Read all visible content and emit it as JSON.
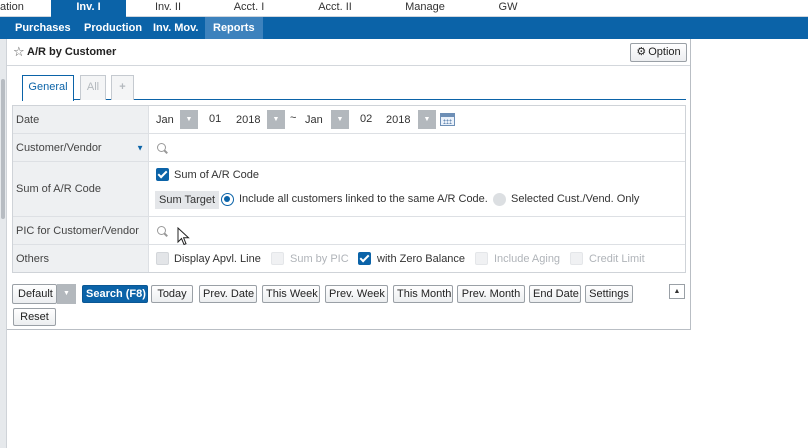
{
  "top_menu": {
    "items": [
      {
        "label": "ation"
      },
      {
        "label": "Inv. I",
        "active": true
      },
      {
        "label": "Inv. II"
      },
      {
        "label": "Acct. I"
      },
      {
        "label": "Acct. II"
      },
      {
        "label": "Manage"
      },
      {
        "label": "GW"
      }
    ]
  },
  "sub_menu": {
    "items": [
      {
        "label": "Purchases"
      },
      {
        "label": "Production"
      },
      {
        "label": "Inv. Mov."
      },
      {
        "label": "Reports",
        "active": true
      }
    ]
  },
  "panel": {
    "title": "A/R by Customer",
    "option_label": "Option",
    "star_icon": "star-outline-icon",
    "gear_icon": "gear-icon"
  },
  "tabs": [
    {
      "label": "General",
      "active": true
    },
    {
      "label": "All"
    },
    {
      "label": "+"
    }
  ],
  "form": {
    "date": {
      "label": "Date",
      "from_month": "Jan",
      "from_day": "01",
      "from_year": "2018",
      "separator": "~",
      "to_month": "Jan",
      "to_day": "02",
      "to_year": "2018"
    },
    "customer_vendor": {
      "label": "Customer/Vendor",
      "value": ""
    },
    "sum_ar_code": {
      "label": "Sum of A/R Code",
      "checkbox_label": "Sum of A/R Code",
      "checked": true,
      "sum_target_label": "Sum Target",
      "option_all": "Include all customers linked to the same A/R Code.",
      "option_selected": "Selected Cust./Vend. Only"
    },
    "pic": {
      "label": "PIC for Customer/Vendor",
      "value": ""
    },
    "others": {
      "label": "Others",
      "display_apvl": "Display Apvl. Line",
      "sum_by_pic": "Sum by PIC",
      "zero_balance": "with Zero Balance",
      "include_aging": "Include Aging",
      "credit_limit": "Credit Limit"
    }
  },
  "buttons": {
    "default": "Default",
    "search": "Search (F8)",
    "today": "Today",
    "prev_date": "Prev. Date",
    "this_week": "This Week",
    "prev_week": "Prev. Week",
    "this_month": "This Month",
    "prev_month": "Prev. Month",
    "end_date": "End Date",
    "settings": "Settings",
    "reset": "Reset"
  },
  "colors": {
    "brand_blue": "#0b63a8",
    "label_bg": "#eef0f2"
  }
}
